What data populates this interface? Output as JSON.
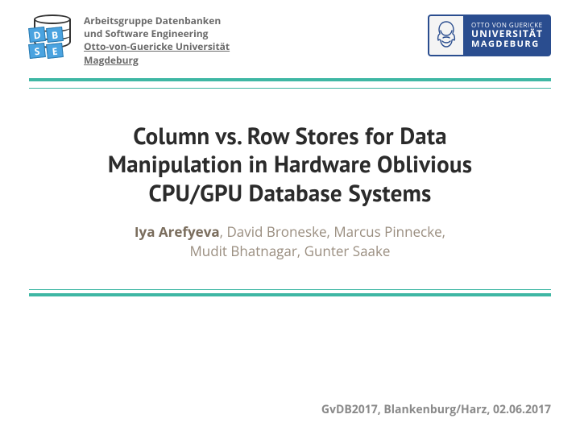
{
  "header": {
    "affiliation": {
      "line1": "Arbeitsgruppe Datenbanken",
      "line2": "und Software Engineering",
      "university": "Otto-von-Guericke Universität",
      "city": "Magdeburg"
    },
    "logo_letters": [
      "D",
      "B",
      "S",
      "E"
    ],
    "ovgu_badge": {
      "line1": "OTTO VON GUERICKE",
      "line2": "UNIVERSITÄT",
      "line3": "MAGDEBURG"
    }
  },
  "title": {
    "line1": "Column vs. Row Stores for Data",
    "line2": "Manipulation in Hardware Oblivious",
    "line3": "CPU/GPU Database Systems"
  },
  "authors": {
    "lead": "Iya Arefyeva",
    "rest_line1": ", David Broneske, Marcus Pinnecke,",
    "line2": "Mudit Bhatnagar, Gunter Saake"
  },
  "footer": "GvDB2017, Blankenburg/Harz, 02.06.2017"
}
